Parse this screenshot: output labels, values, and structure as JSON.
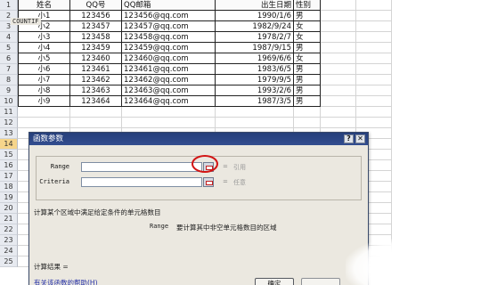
{
  "sheet": {
    "header_row": {
      "row_number": "1",
      "cells": [
        "姓名",
        "QQ号",
        "QQ邮箱",
        "出生日期",
        "性别"
      ]
    },
    "rows": [
      {
        "row_number": "2",
        "cells": [
          "小1",
          "123456",
          "123456@qq.com",
          "1990/1/6",
          "男"
        ]
      },
      {
        "row_number": "3",
        "cells": [
          "小2",
          "123457",
          "123457@qq.com",
          "1982/9/24",
          "女"
        ]
      },
      {
        "row_number": "4",
        "cells": [
          "小3",
          "123458",
          "123458@qq.com",
          "1978/2/7",
          "女"
        ]
      },
      {
        "row_number": "5",
        "cells": [
          "小4",
          "123459",
          "123459@qq.com",
          "1987/9/15",
          "男"
        ]
      },
      {
        "row_number": "6",
        "cells": [
          "小5",
          "123460",
          "123460@qq.com",
          "1969/6/6",
          "女"
        ]
      },
      {
        "row_number": "7",
        "cells": [
          "小6",
          "123461",
          "123461@qq.com",
          "1983/6/5",
          "男"
        ]
      },
      {
        "row_number": "8",
        "cells": [
          "小7",
          "123462",
          "123462@qq.com",
          "1979/9/5",
          "男"
        ]
      },
      {
        "row_number": "9",
        "cells": [
          "小8",
          "123463",
          "123463@qq.com",
          "1993/2/6",
          "男"
        ]
      },
      {
        "row_number": "10",
        "cells": [
          "小9",
          "123464",
          "123464@qq.com",
          "1987/3/5",
          "男"
        ]
      }
    ],
    "empty_rows": [
      "11",
      "12",
      "13",
      "14",
      "15",
      "16",
      "17",
      "18",
      "19",
      "20",
      "21",
      "22",
      "23",
      "24",
      "25"
    ],
    "active_row": "14"
  },
  "dialog": {
    "title": "函数参数",
    "help_glyph": "?",
    "close_glyph": "✕",
    "function_name": "COUNTIF",
    "args": [
      {
        "label": "Range",
        "value": "",
        "hint": "引用"
      },
      {
        "label": "Criteria",
        "value": "",
        "hint": "任意"
      }
    ],
    "equals_sign": "=",
    "function_description": "计算某个区域中满足给定条件的单元格数目",
    "arg_description_name": "Range",
    "arg_description": "要计算其中非空单元格数目的区域",
    "result_label": "计算结果 =",
    "help_link": "有关该函数的帮助(H)",
    "ok_label": "确定",
    "cancel_label": ""
  },
  "colors": {
    "title_bar": "#253e7a",
    "highlight_circle": "#d21414",
    "active_row_header": "#f6d58b"
  }
}
